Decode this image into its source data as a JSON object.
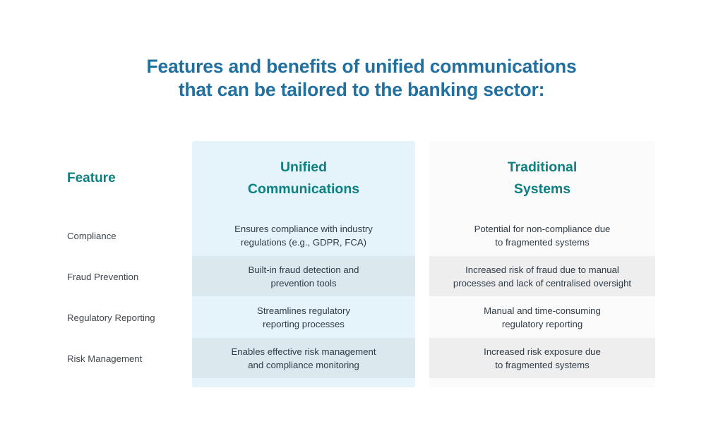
{
  "title": {
    "line1": "Features and benefits of unified communications",
    "line2": "that can be tailored to the banking sector:"
  },
  "colors": {
    "title": "#22709f",
    "header_accent": "#0f8080",
    "panel_unified": "#e5f3fb",
    "panel_unified_stripe": "#dbe9ef",
    "panel_traditional": "#fbfbfb",
    "panel_traditional_stripe": "#eeeeee",
    "feature_label": "#3f464d",
    "cell_text": "#2f3b47",
    "background": "#ffffff"
  },
  "table": {
    "headers": {
      "feature": "Feature",
      "unified_line1": "Unified",
      "unified_line2": "Communications",
      "traditional_line1": "Traditional",
      "traditional_line2": "Systems"
    },
    "rows": [
      {
        "feature": "Compliance",
        "unified_line1": "Ensures compliance with industry",
        "unified_line2": "regulations (e.g., GDPR, FCA)",
        "traditional_line1": "Potential for non-compliance due",
        "traditional_line2": "to fragmented systems"
      },
      {
        "feature": "Fraud Prevention",
        "unified_line1": "Built-in fraud detection and",
        "unified_line2": "prevention tools",
        "traditional_line1": "Increased risk of fraud due to manual",
        "traditional_line2": "processes and lack of centralised oversight"
      },
      {
        "feature": "Regulatory Reporting",
        "unified_line1": "Streamlines regulatory",
        "unified_line2": "reporting processes",
        "traditional_line1": "Manual and time-consuming",
        "traditional_line2": "regulatory reporting"
      },
      {
        "feature": "Risk Management",
        "unified_line1": "Enables effective risk management",
        "unified_line2": "and compliance monitoring",
        "traditional_line1": "Increased risk exposure due",
        "traditional_line2": "to fragmented systems"
      }
    ]
  }
}
